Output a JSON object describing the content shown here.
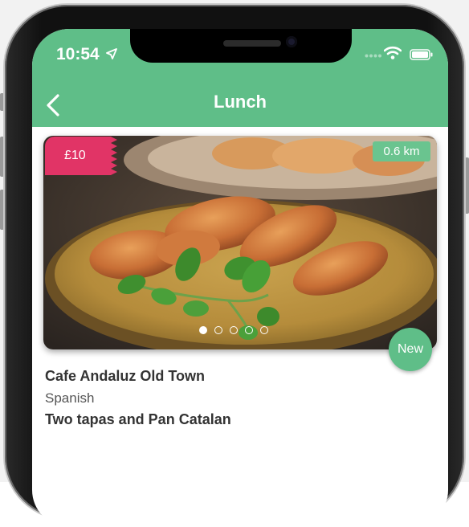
{
  "status_bar": {
    "time": "10:54",
    "icons": [
      "location-arrow-icon",
      "signal-dots-icon",
      "wifi-icon",
      "battery-icon"
    ]
  },
  "nav": {
    "title": "Lunch",
    "back_icon": "chevron-left-icon"
  },
  "card": {
    "price": "£10",
    "distance": "0.6 km",
    "badge": "New",
    "carousel": {
      "total": 5,
      "active": 1
    },
    "image": "grilled-chicken-plate-photo",
    "restaurant_name": "Cafe Andaluz Old Town",
    "cuisine": "Spanish",
    "deal": "Two tapas and Pan Catalan"
  },
  "colors": {
    "header_green": "#5fbe88",
    "price_pink": "#e13466",
    "distance_green": "#6ac48f"
  }
}
